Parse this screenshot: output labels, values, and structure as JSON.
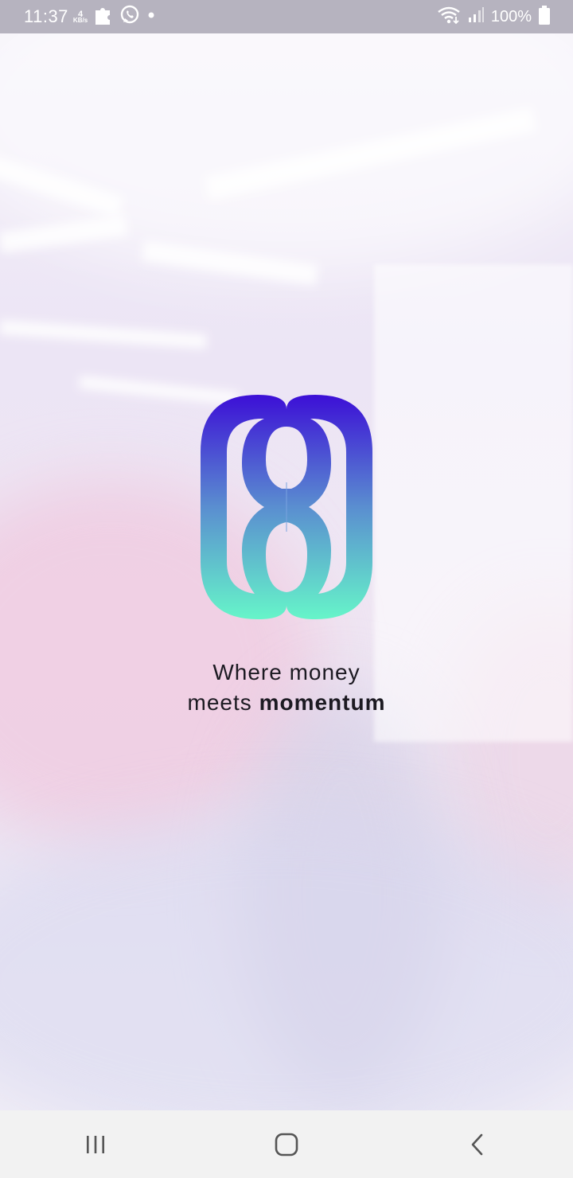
{
  "status_bar": {
    "time": "11:37",
    "net_speed_value": "4",
    "net_speed_unit": "KB/s",
    "icons": [
      "puzzle-icon",
      "whatsapp-icon",
      "dot-icon",
      "wifi-icon",
      "signal-icon",
      "battery-icon"
    ],
    "battery": "100%"
  },
  "splash": {
    "tagline_line1": "Where money",
    "tagline_line2_regular": "meets ",
    "tagline_line2_bold": "momentum",
    "logo_gradient_top": "#3c0fd6",
    "logo_gradient_bottom": "#66f5c9"
  },
  "nav_bar": {
    "items": [
      "recent-apps-icon",
      "home-icon",
      "back-icon"
    ]
  }
}
